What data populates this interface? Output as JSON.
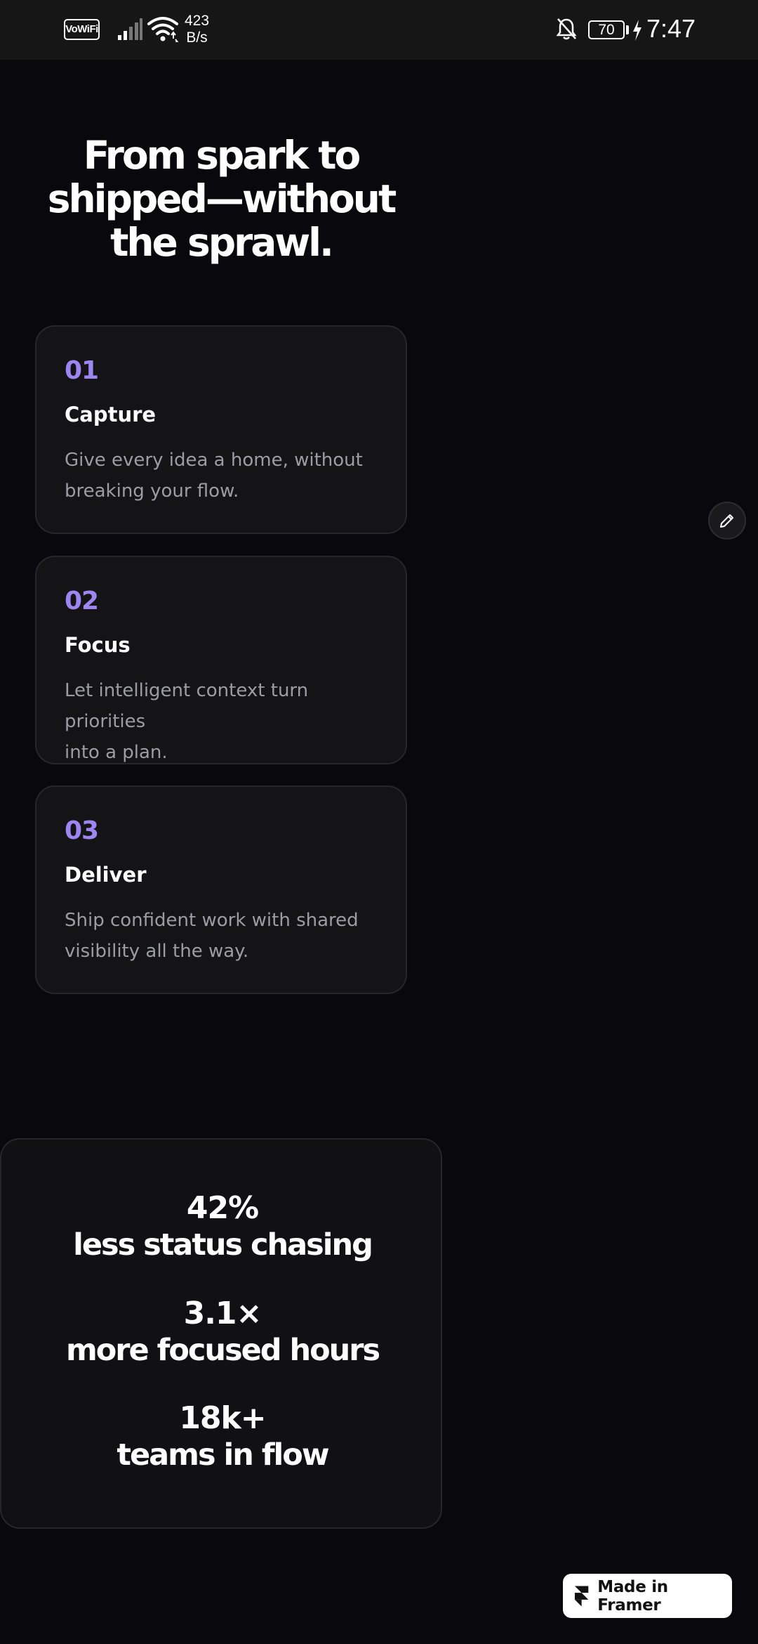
{
  "status_bar": {
    "wifi_calling_label": "VoWiFi",
    "speed_value": "423",
    "speed_unit": "B/s",
    "battery_level": "70",
    "time": "7:47",
    "icons": [
      "signal-icon",
      "wifi-icon",
      "bell-off-icon",
      "battery-icon",
      "charging-bolt-icon"
    ]
  },
  "hero": {
    "headline_line1": "From spark to",
    "headline_line2": "shipped—without",
    "headline_line3": "the sprawl."
  },
  "steps": [
    {
      "number": "01",
      "title": "Capture",
      "desc_line1": "Give every idea a home, without",
      "desc_line2": "breaking your flow."
    },
    {
      "number": "02",
      "title": "Focus",
      "desc_line1": "Let intelligent context turn priorities",
      "desc_line2": "into a plan."
    },
    {
      "number": "03",
      "title": "Deliver",
      "desc_line1": "Ship confident work with shared",
      "desc_line2": "visibility all the way."
    }
  ],
  "stats": [
    {
      "value": "42%",
      "label": "less status chasing"
    },
    {
      "value": "3.1×",
      "label": "more focused hours"
    },
    {
      "value": "18k+",
      "label": "teams in flow"
    }
  ],
  "floating_action": {
    "icon": "pencil-icon"
  },
  "framer_badge": {
    "label": "Made in Framer",
    "icon": "framer-logo-icon"
  },
  "colors": {
    "background": "#09080d",
    "card": "#141417",
    "accent": "#9d86f2",
    "muted_text": "#9c9ca4"
  }
}
